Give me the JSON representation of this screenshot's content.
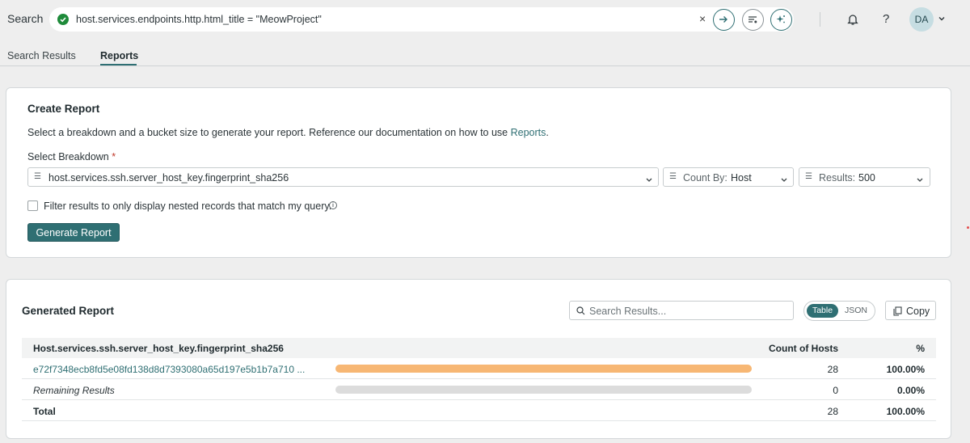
{
  "header": {
    "search_label": "Search",
    "query": "host.services.endpoints.http.html_title = \"MeowProject\"",
    "clear_symbol": "×",
    "avatar_initials": "DA",
    "help_symbol": "?"
  },
  "tabs": [
    {
      "label": "Search Results",
      "active": false
    },
    {
      "label": "Reports",
      "active": true
    }
  ],
  "create_report": {
    "title": "Create Report",
    "description_prefix": "Select a breakdown and a bucket size to generate your report. Reference our documentation on how to use ",
    "description_link": "Reports",
    "description_suffix": ".",
    "breakdown_label": "Select Breakdown",
    "required_mark": "*",
    "breakdown_value": "host.services.ssh.server_host_key.fingerprint_sha256",
    "count_by_label": "Count By:",
    "count_by_value": "Host",
    "results_label": "Results:",
    "results_value": "500",
    "filter_label": "Filter results to only display nested records that match my query.",
    "info_symbol": "i",
    "generate_button": "Generate Report"
  },
  "generated_report": {
    "title": "Generated Report",
    "search_placeholder": "Search Results...",
    "toggle_table": "Table",
    "toggle_json": "JSON",
    "copy_label": "Copy",
    "columns": [
      "Host.services.ssh.server_host_key.fingerprint_sha256",
      "Count of Hosts",
      "%"
    ],
    "rows": [
      {
        "key": "e72f7348ecb8fd5e08fd138d8d7393080a65d197e5b1b7a710 ...",
        "count": "28",
        "percent": "100.00%",
        "fraction": 1.0,
        "bar_color": "#f7b774"
      },
      {
        "key": "Remaining Results",
        "count": "0",
        "percent": "0.00%",
        "fraction": 1.0,
        "bar_color": "#dcdcdc"
      },
      {
        "key": "Total",
        "count": "28",
        "percent": "100.00%"
      }
    ]
  },
  "colors": {
    "accent": "#2f6f73",
    "success": "#1e8a3a",
    "bar_primary": "#f7b774",
    "bar_remaining": "#dcdcdc"
  }
}
